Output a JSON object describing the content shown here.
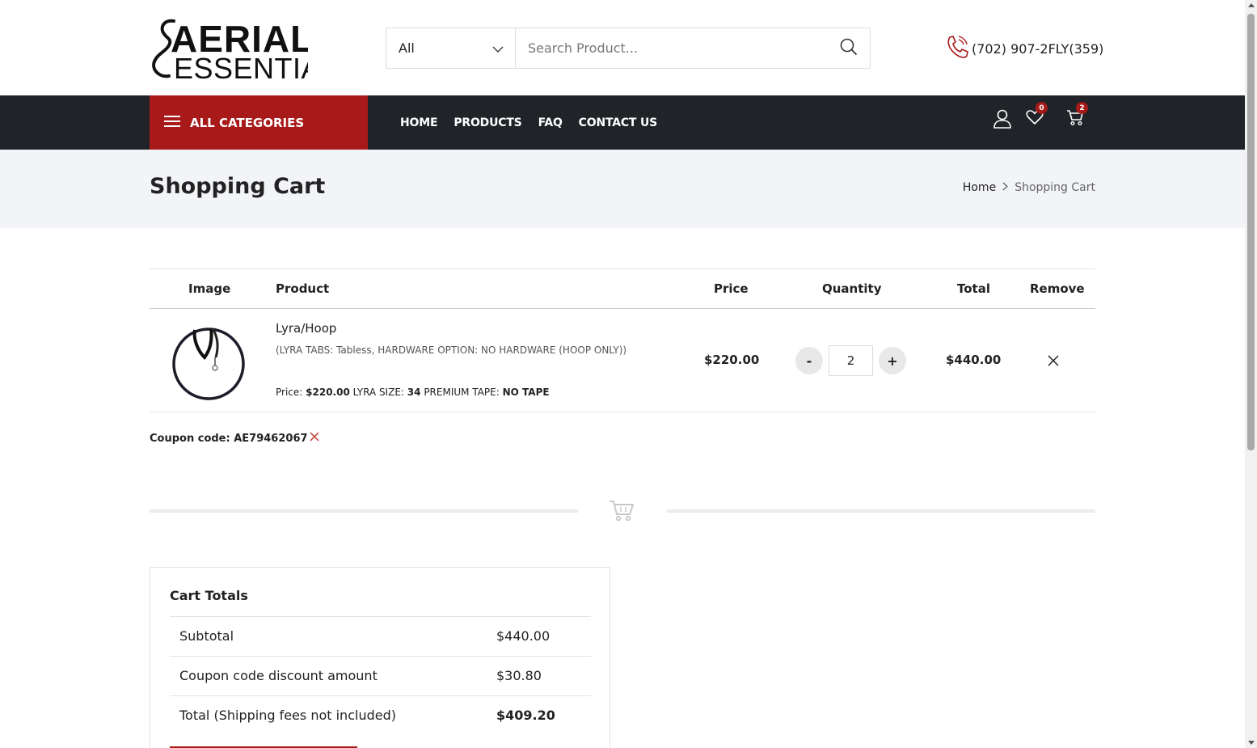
{
  "header": {
    "logo_text_top": "AERIAL",
    "logo_text_bottom": "ESSENTIALS",
    "search": {
      "category_selected": "All",
      "placeholder": "Search Product..."
    },
    "phone": "(702) 907-2FLY(359)"
  },
  "nav": {
    "all_categories_label": "ALL CATEGORIES",
    "links": [
      "HOME",
      "PRODUCTS",
      "FAQ",
      "CONTACT US"
    ],
    "wishlist_count": "0",
    "cart_count": "2"
  },
  "title_band": {
    "title": "Shopping Cart",
    "breadcrumb": {
      "home": "Home",
      "current": "Shopping Cart"
    }
  },
  "cart": {
    "headers": {
      "image": "Image",
      "product": "Product",
      "price": "Price",
      "quantity": "Quantity",
      "total": "Total",
      "remove": "Remove"
    },
    "items": [
      {
        "name": "Lyra/Hoop",
        "options": "(LYRA TABS: Tabless, HARDWARE OPTION: NO HARDWARE (HOOP ONLY))",
        "meta_price_label": "Price:",
        "meta_price": "$220.00",
        "meta_size_label": "LYRA SIZE:",
        "meta_size": "34",
        "meta_tape_label": "PREMIUM TAPE:",
        "meta_tape": "NO TAPE",
        "price": "$220.00",
        "quantity": "2",
        "qty_minus": "-",
        "qty_plus": "+",
        "total": "$440.00"
      }
    ],
    "coupon": "Coupon code: AE79462067"
  },
  "totals": {
    "title": "Cart Totals",
    "rows": [
      {
        "label": "Subtotal",
        "value": "$440.00"
      },
      {
        "label": "Coupon code discount amount",
        "value": "$30.80"
      },
      {
        "label": "Total (Shipping fees not included)",
        "value": "$409.20"
      }
    ]
  },
  "colors": {
    "brand_red": "#a81a1a",
    "nav_dark": "#202328",
    "band_bg": "#f2f4f8"
  }
}
